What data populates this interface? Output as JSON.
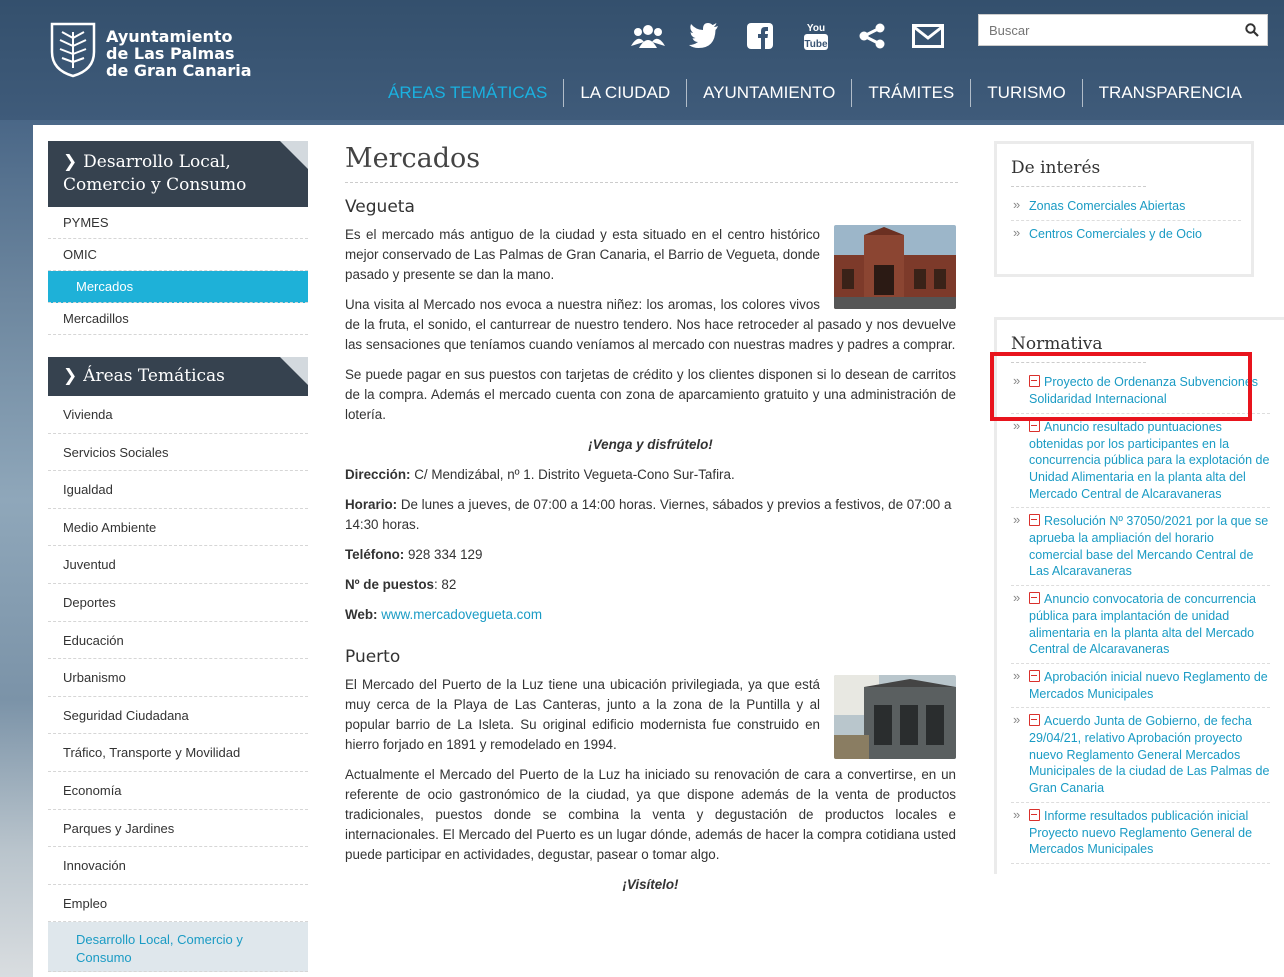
{
  "header": {
    "logo_line1": "Ayuntamiento",
    "logo_line2": "de Las Palmas",
    "logo_line3": "de Gran Canaria",
    "social_icons": [
      "community-icon",
      "twitter-icon",
      "facebook-icon",
      "youtube-icon",
      "share-icon",
      "mail-icon"
    ],
    "search_placeholder": "Buscar",
    "nav": [
      "ÁREAS TEMÁTICAS",
      "LA CIUDAD",
      "AYUNTAMIENTO",
      "TRÁMITES",
      "TURISMO",
      "TRANSPARENCIA"
    ]
  },
  "sidebar": {
    "section1_title": "Desarrollo Local, Comercio y Consumo",
    "section1_items": [
      "PYMES",
      "OMIC",
      "Mercados",
      "Mercadillos"
    ],
    "section2_title": "Áreas Temáticas",
    "section2_items": [
      "Vivienda",
      "Servicios Sociales",
      "Igualdad",
      "Medio Ambiente",
      "Juventud",
      "Deportes",
      "Educación",
      "Urbanismo",
      "Seguridad Ciudadana",
      "Tráfico, Transporte y Movilidad",
      "Economía",
      "Parques y Jardines",
      "Innovación",
      "Empleo",
      "Desarrollo Local, Comercio y Consumo"
    ]
  },
  "main": {
    "title": "Mercados",
    "vegueta": {
      "heading": "Vegueta",
      "p1": "Es el mercado más antiguo de la ciudad y esta situado en el centro histórico mejor conservado de Las Palmas de Gran Canaria, el Barrio de Vegueta, donde pasado y presente se dan la mano.",
      "p2": "Una visita al Mercado  nos evoca a nuestra niñez: los aromas, los colores vivos de la fruta, el sonido, el canturrear de nuestro tendero. Nos hace retroceder al pasado y nos devuelve las sensaciones que teníamos cuando veníamos al mercado con nuestras madres y padres a comprar.",
      "p3": "Se puede pagar en sus puestos con tarjetas de crédito y los clientes disponen si lo desean de carritos de la compra. Además el mercado cuenta con zona de aparcamiento gratuito y una administración de lotería.",
      "slogan": "¡Venga y disfrútelo!",
      "dir_label": "Dirección:",
      "dir_value": " C/ Mendizábal, nº 1. Distrito Vegueta-Cono Sur-Tafira.",
      "hor_label": "Horario:",
      "hor_value": " De lunes a jueves, de 07:00 a 14:00 horas. Viernes, sábados y previos a festivos, de 07:00 a 14:30 horas.",
      "tel_label": "Teléfono:",
      "tel_value": " 928 334 129",
      "puestos_label": "Nº de puestos",
      "puestos_value": ": 82",
      "web_label": "Web:",
      "web_value": "www.mercadovegueta.com"
    },
    "puerto": {
      "heading": "Puerto",
      "p1": "El Mercado del Puerto de la Luz tiene una ubicación privilegiada, ya que está muy cerca de la Playa de Las Canteras, junto a la zona de la Puntilla y al popular barrio de La Isleta. Su original edificio modernista fue construido en hierro forjado en 1891 y remodelado en 1994.",
      "p2": "Actualmente el Mercado del Puerto de la Luz ha iniciado su renovación de cara a convertirse, en un referente de ocio gastronómico de la ciudad, ya que dispone además de la venta de productos tradicionales, puestos donde se combina la venta y degustación de productos locales e internacionales. El Mercado del Puerto es un lugar dónde, además de hacer la compra cotidiana usted puede participar en actividades, degustar, pasear o tomar algo.",
      "slogan": "¡Visítelo!"
    }
  },
  "right": {
    "interes_title": "De interés",
    "interes_items": [
      "Zonas Comerciales Abiertas",
      "Centros Comerciales y de Ocio"
    ],
    "normativa_title": "Normativa",
    "normativa_items": [
      "Proyecto de Ordenanza Subvenciones Solidaridad Internacional",
      "Anuncio resultado puntuaciones obtenidas por los participantes en la concurrencia pública para la explotación de Unidad Alimentaria en la planta alta del Mercado Central de Alcaravaneras",
      "Resolución Nº 37050/2021 por la que se aprueba la ampliación del horario comercial base del Mercando Central de Las Alcaravaneras",
      "Anuncio convocatoria de concurrencia pública para implantación de unidad alimentaria en la planta alta del Mercado Central de Alcaravaneras",
      "Aprobación inicial nuevo Reglamento de Mercados Municipales",
      "Acuerdo Junta de Gobierno, de fecha 29/04/21, relativo Aprobación proyecto nuevo Reglamento General Mercados Municipales de la ciudad de Las Palmas de Gran Canaria",
      "Informe resultados publicación inicial Proyecto nuevo Reglamento General de Mercados Municipales"
    ]
  },
  "colors": {
    "accent": "#1ab1e0",
    "header": "#3a5574",
    "highlight": "#e8141d"
  }
}
